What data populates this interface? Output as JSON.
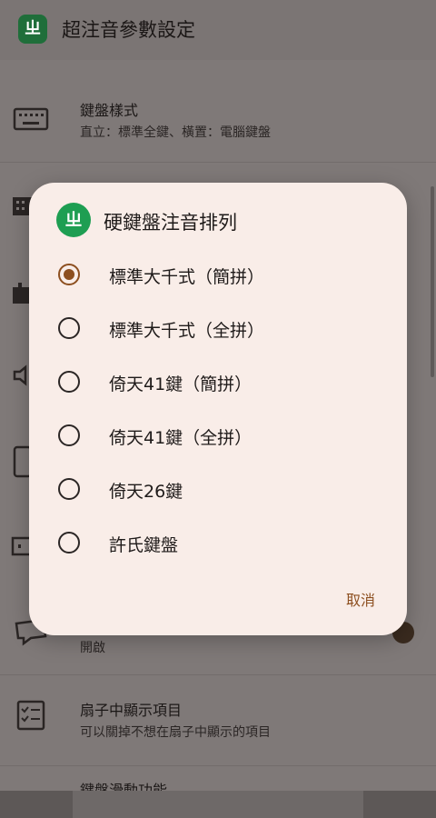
{
  "app_bar": {
    "logo": "ㄓ",
    "title": "超注音參數設定"
  },
  "settings": [
    {
      "title": "鍵盤樣式",
      "subtitle": "直立：標準全鍵、橫置：電腦鍵盤",
      "icon": "keyboard-icon"
    },
    {
      "title": "",
      "subtitle": "開啟",
      "icon": "chat-bubble-icon"
    },
    {
      "title": "扇子中顯示項目",
      "subtitle": "可以關掉不想在扇子中顯示的項目",
      "icon": "checklist-icon"
    },
    {
      "title": "鍵盤滑動功能",
      "subtitle": "",
      "icon": "swipe-icon"
    }
  ],
  "dialog": {
    "logo": "ㄓ",
    "title": "硬鍵盤注音排列",
    "options": [
      {
        "label": "標準大千式（簡拼）",
        "selected": true
      },
      {
        "label": "標準大千式（全拼）",
        "selected": false
      },
      {
        "label": "倚天41鍵（簡拼）",
        "selected": false
      },
      {
        "label": "倚天41鍵（全拼）",
        "selected": false
      },
      {
        "label": "倚天26鍵",
        "selected": false
      },
      {
        "label": "許氏鍵盤",
        "selected": false
      }
    ],
    "cancel_label": "取消"
  },
  "colors": {
    "accent": "#8d4f1f",
    "dialog_bg": "#f9ede8",
    "logo_green": "#1e9e52",
    "scrim": "#7f7978"
  }
}
